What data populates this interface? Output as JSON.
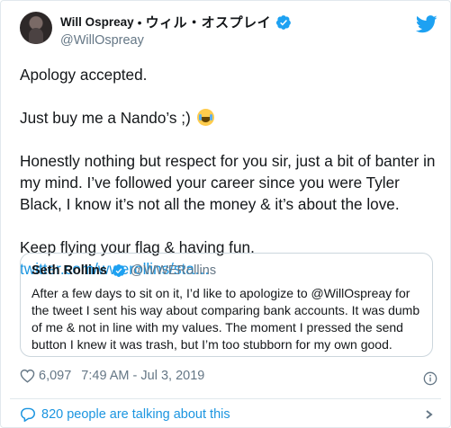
{
  "author": {
    "display_name": "Will Ospreay",
    "separator": "•",
    "japanese_name": "ウィル・オスプレイ",
    "handle": "@WillOspreay"
  },
  "tweet": {
    "paragraph_1": "Apology accepted.",
    "paragraph_2": "Just buy me a Nando’s ;)",
    "paragraph_3": "Honestly nothing but respect for you sir, just a bit of banter in my mind. I’ve followed your career since you were Tyler Black, I know it’s not all the money & it’s about the love.",
    "paragraph_4_text": "Keep flying your flag & having fun. ",
    "paragraph_4_link": "twitter.com/wwerollins/sta…"
  },
  "quoted_tweet": {
    "name": "Seth Rollins",
    "handle": "@WWERollins",
    "text": "After a few days to sit on it, I’d like to apologize to @WillOspreay for the tweet I sent his way about comparing bank accounts. It was dumb of me & not in line with my values. The moment I pressed the send button I knew it was trash, but I’m too stubborn for my own good."
  },
  "meta": {
    "likes": "6,097",
    "timestamp": "7:49 AM - Jul 3, 2019"
  },
  "footer": {
    "talking_text": "820 people are talking about this"
  },
  "colors": {
    "link": "#1b95e0",
    "verified": "#1da1f2",
    "muted": "#657786"
  },
  "icons": [
    "avatar",
    "verified-badge-icon",
    "twitter-bird-icon",
    "heart-icon",
    "info-icon",
    "comment-bubble-icon",
    "chevron-right-icon",
    "tears-of-joy-emoji"
  ]
}
